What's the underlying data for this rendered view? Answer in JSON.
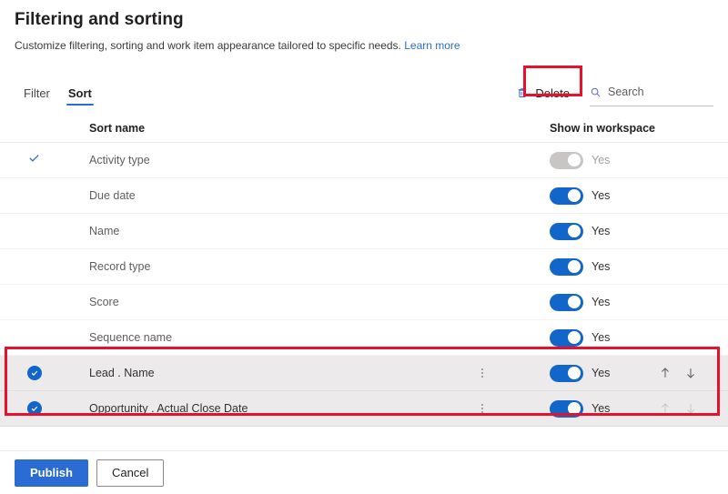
{
  "header": {
    "title": "Filtering and sorting",
    "subtitle": "Customize filtering, sorting and work item appearance tailored to specific needs.",
    "learn_more": "Learn more"
  },
  "tabs": [
    {
      "label": "Filter",
      "active": false
    },
    {
      "label": "Sort",
      "active": true
    }
  ],
  "toolbar": {
    "delete_label": "Delete",
    "delete_icon": "trash-icon",
    "search_icon": "search-icon",
    "search_value": "",
    "search_placeholder": "Search"
  },
  "table": {
    "headers": {
      "sort_name": "Sort name",
      "show_in_workspace": "Show in workspace"
    },
    "rows": [
      {
        "label": "Activity type",
        "marker": "check-icon",
        "selected": false,
        "toggle_on": false,
        "toggle_disabled": true,
        "toggle_label": "Yes",
        "has_menu": false,
        "has_arrows": false
      },
      {
        "label": "Due date",
        "marker": "none",
        "selected": false,
        "toggle_on": true,
        "toggle_disabled": false,
        "toggle_label": "Yes",
        "has_menu": false,
        "has_arrows": false
      },
      {
        "label": "Name",
        "marker": "none",
        "selected": false,
        "toggle_on": true,
        "toggle_disabled": false,
        "toggle_label": "Yes",
        "has_menu": false,
        "has_arrows": false
      },
      {
        "label": "Record type",
        "marker": "none",
        "selected": false,
        "toggle_on": true,
        "toggle_disabled": false,
        "toggle_label": "Yes",
        "has_menu": false,
        "has_arrows": false
      },
      {
        "label": "Score",
        "marker": "none",
        "selected": false,
        "toggle_on": true,
        "toggle_disabled": false,
        "toggle_label": "Yes",
        "has_menu": false,
        "has_arrows": false
      },
      {
        "label": "Sequence name",
        "marker": "none",
        "selected": false,
        "toggle_on": true,
        "toggle_disabled": false,
        "toggle_label": "Yes",
        "has_menu": false,
        "has_arrows": false
      },
      {
        "label": "Lead . Name",
        "marker": "checkbox-selected",
        "selected": true,
        "toggle_on": true,
        "toggle_disabled": false,
        "toggle_label": "Yes",
        "has_menu": true,
        "has_arrows": true,
        "up_disabled": false,
        "down_disabled": false
      },
      {
        "label": "Opportunity . Actual Close Date",
        "marker": "checkbox-selected",
        "selected": true,
        "toggle_on": true,
        "toggle_disabled": false,
        "toggle_label": "Yes",
        "has_menu": true,
        "has_arrows": true,
        "up_disabled": true,
        "down_disabled": true
      }
    ]
  },
  "footer": {
    "publish_label": "Publish",
    "cancel_label": "Cancel"
  },
  "annotations": [
    {
      "name": "delete-highlight"
    },
    {
      "name": "selected-rows-highlight"
    }
  ],
  "colors": {
    "accent": "#2b6cd4",
    "toggle_on": "#1266c9",
    "toggle_off": "#c8c6c4",
    "annotation": "#e8112d",
    "selected_row_bg": "#eceaea"
  }
}
